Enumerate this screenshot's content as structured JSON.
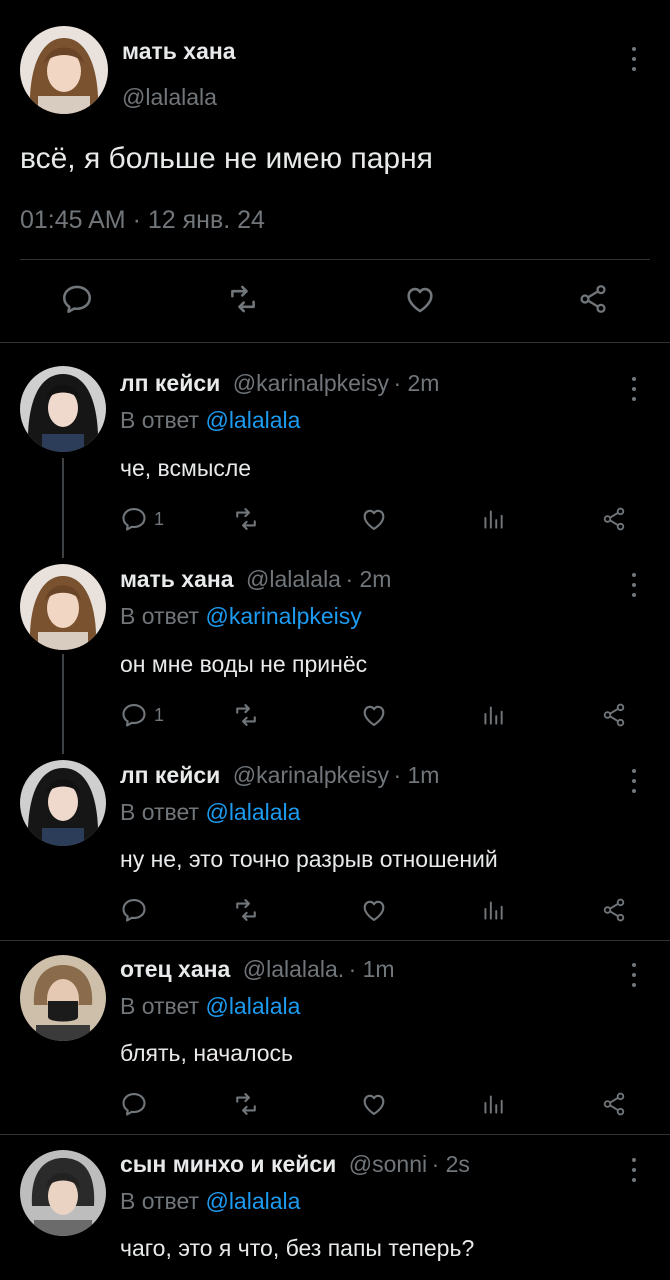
{
  "main_tweet": {
    "name": "мать хана",
    "handle": "@lalalala",
    "text": "всё, я больше не имею парня",
    "timestamp": "01:45 AM · 12 янв. 24"
  },
  "replies": [
    {
      "name": "лп кейси",
      "handle": "@karinalpkeisy",
      "time": "· 2m",
      "reply_prefix": "В ответ",
      "reply_to": "@lalalala",
      "text": "че, всмысле",
      "reply_count": "1"
    },
    {
      "name": "мать хана",
      "handle": "@lalalala",
      "time": "· 2m",
      "reply_prefix": "В ответ",
      "reply_to": "@karinalpkeisy",
      "text": "он мне воды не принёс",
      "reply_count": "1"
    },
    {
      "name": "лп кейси",
      "handle": "@karinalpkeisy",
      "time": "· 1m",
      "reply_prefix": "В ответ",
      "reply_to": "@lalalala",
      "text": "ну не, это точно разрыв отношений",
      "reply_count": ""
    },
    {
      "name": "отец хана",
      "handle": "@lalalala.",
      "time": "· 1m",
      "reply_prefix": "В ответ",
      "reply_to": "@lalalala",
      "text": "блять, началось",
      "reply_count": ""
    },
    {
      "name": "сын минхо и кейси",
      "handle": "@sonni",
      "time": "· 2s",
      "reply_prefix": "В ответ",
      "reply_to": "@lalalala",
      "text": "чаго, это я что, без папы теперь?",
      "reply_count": ""
    }
  ],
  "colors": {
    "background": "#000000",
    "text": "#e7e9ea",
    "muted": "#71767b",
    "link": "#1d9bf0",
    "divider": "#2f3336"
  },
  "icons": [
    "reply-icon",
    "retweet-icon",
    "like-icon",
    "share-icon",
    "views-icon",
    "more-icon"
  ]
}
